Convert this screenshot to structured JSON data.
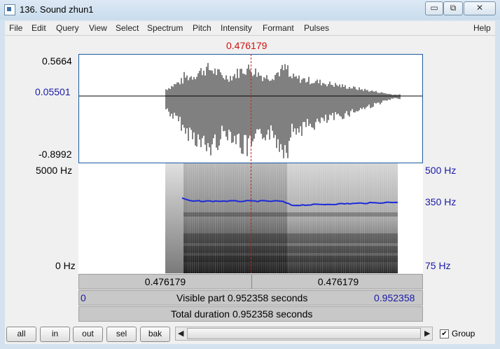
{
  "window": {
    "title": "136. Sound zhun1",
    "min_label": "▭",
    "max_label": "⧉",
    "close_label": "✕"
  },
  "menu": [
    "File",
    "Edit",
    "Query",
    "View",
    "Select",
    "Spectrum",
    "Pitch",
    "Intensity",
    "Formant",
    "Pulses",
    "Help"
  ],
  "cursor_time": "0.476179",
  "waveform": {
    "ymax": "0.5664",
    "ycursor": "0.05501",
    "ymin": "-0.8992"
  },
  "spectrogram": {
    "fmax": "5000 Hz",
    "fmin": "0 Hz",
    "pitch_max": "500 Hz",
    "pitch_cursor": "350 Hz",
    "pitch_min": "75 Hz"
  },
  "time_bar": {
    "left": "0.476179",
    "right": "0.476179"
  },
  "visible_bar": {
    "start": "0",
    "text": "Visible part 0.952358 seconds",
    "end": "0.952358"
  },
  "total_bar": {
    "text": "Total duration 0.952358 seconds"
  },
  "buttons": {
    "all": "all",
    "in": "in",
    "out": "out",
    "sel": "sel",
    "bak": "bak"
  },
  "group_label": "Group",
  "colors": {
    "cursor": "#d01010",
    "pitch": "#1a2ad8",
    "axis_blue": "#1a1aa8"
  }
}
